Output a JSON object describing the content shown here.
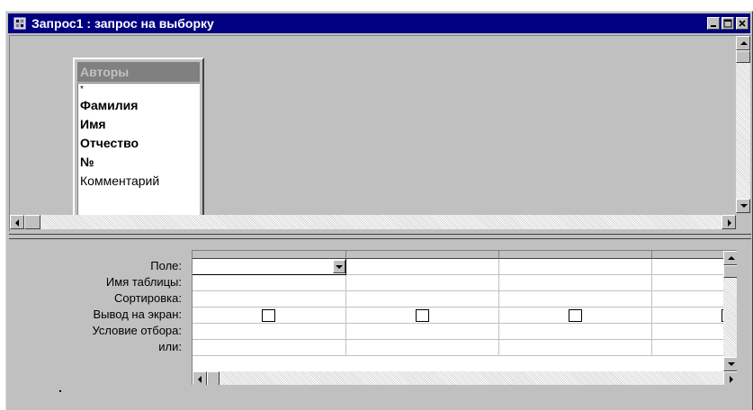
{
  "window": {
    "title": "Запрос1 : запрос на выборку",
    "title_bar_color": "#000080",
    "controls": [
      "minimize-icon",
      "maximize-icon",
      "close-icon"
    ]
  },
  "table": {
    "name": "Авторы",
    "fields": [
      {
        "label": "*",
        "bold": false
      },
      {
        "label": "Фамилия",
        "bold": true
      },
      {
        "label": "Имя",
        "bold": true
      },
      {
        "label": "Отчество",
        "bold": true
      },
      {
        "label": "№",
        "bold": true
      },
      {
        "label": "Комментарий",
        "bold": false
      }
    ]
  },
  "grid": {
    "row_labels": [
      "Поле:",
      "Имя таблицы:",
      "Сортировка:",
      "Вывод на экран:",
      "Условие отбора:",
      "или:"
    ],
    "columns": 4
  }
}
